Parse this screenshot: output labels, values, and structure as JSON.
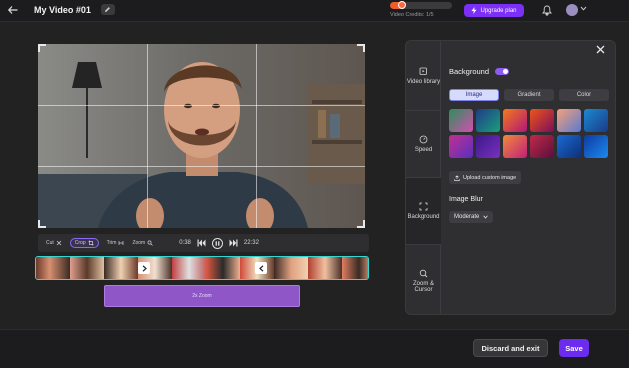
{
  "header": {
    "title": "My Video #01",
    "credits_label": "Video Credits: 1/5",
    "credits_fraction": 0.2,
    "upgrade_label": "Upgrade plan",
    "icons": {
      "back": "arrow-left-icon",
      "edit": "pencil-icon",
      "upgrade": "bolt-icon",
      "bell": "bell-icon",
      "avatar_chevron": "chevron-down-icon"
    }
  },
  "controls": {
    "cut_label": "Cut",
    "crop_label": "Crop",
    "trim_label": "Trim",
    "zoom_label": "Zoom",
    "current_time": "0:38",
    "total_time": "22:32"
  },
  "timeline": {
    "zoom_segment_label": "2x Zoom"
  },
  "sidebar": {
    "tabs": [
      {
        "label": "Video library",
        "icon": "video-library-icon"
      },
      {
        "label": "Speed",
        "icon": "speedometer-icon"
      },
      {
        "label": "Background",
        "icon": "background-icon"
      },
      {
        "label": "Zoom & Cursor",
        "icon": "zoom-cursor-icon"
      }
    ],
    "active_tab": "Background"
  },
  "panel": {
    "background_label": "Background",
    "background_enabled": true,
    "segments": [
      "Image",
      "Gradient",
      "Color"
    ],
    "active_segment": "Image",
    "upload_label": "Upload custom image",
    "blur_label": "Image Blur",
    "blur_value": "Moderate",
    "thumb_colors": [
      [
        "#2b8f5a",
        "#d44fb0"
      ],
      [
        "#1f3a8a",
        "#1aa07a"
      ],
      [
        "#f47a1a",
        "#b0177a"
      ],
      [
        "#f0541a",
        "#7a0f5a"
      ],
      [
        "#f4a07a",
        "#5a7ad0"
      ],
      [
        "#1a8ad0",
        "#1a3a8a"
      ],
      [
        "#c0308f",
        "#5a2fc0"
      ],
      [
        "#3a1a8a",
        "#7a2fc0"
      ],
      [
        "#f08a3a",
        "#c0207a"
      ],
      [
        "#c02a4a",
        "#5a0f3a"
      ],
      [
        "#1a6ad0",
        "#0f2f7a"
      ],
      [
        "#0f3aa0",
        "#1a8af0"
      ]
    ]
  },
  "footer": {
    "discard_label": "Discard and exit",
    "save_label": "Save"
  },
  "colors": {
    "accent": "#7b2ff7",
    "timeline_border": "#38d6d0",
    "zoom_segment": "#8e56c7"
  }
}
